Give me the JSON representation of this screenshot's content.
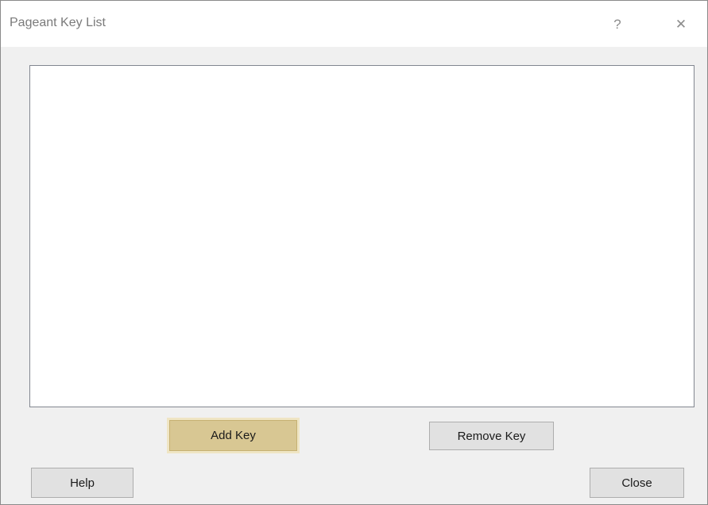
{
  "window": {
    "title": "Pageant Key List",
    "help_glyph": "?",
    "close_glyph": "✕"
  },
  "key_list": {
    "items": []
  },
  "buttons": {
    "add_key": "Add Key",
    "remove_key": "Remove Key",
    "help": "Help",
    "close": "Close"
  },
  "colors": {
    "focused_button": "#d8c793",
    "window_background": "#f0f0f0"
  }
}
